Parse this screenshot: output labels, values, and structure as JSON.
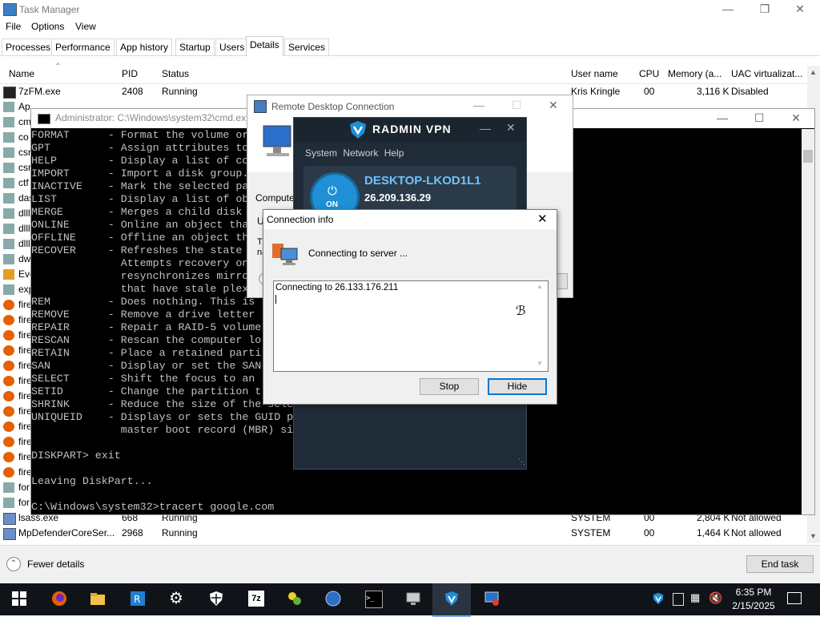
{
  "task_manager": {
    "title": "Task Manager",
    "menu": [
      "File",
      "Options",
      "View"
    ],
    "tabs": [
      "Processes",
      "Performance",
      "App history",
      "Startup",
      "Users",
      "Details",
      "Services"
    ],
    "active_tab": "Details",
    "columns": [
      "Name",
      "PID",
      "Status",
      "User name",
      "CPU",
      "Memory (a...",
      "UAC virtualizat..."
    ],
    "rows_top": [
      {
        "name": "7zFM.exe",
        "pid": "2408",
        "status": "Running",
        "user": "Kris Kringle",
        "cpu": "00",
        "mem": "3,116 K",
        "uac": "Disabled"
      }
    ],
    "rows_bottom": [
      {
        "name": "lsass.exe",
        "pid": "668",
        "status": "Running",
        "user": "SYSTEM",
        "cpu": "00",
        "mem": "2,804 K",
        "uac": "Not allowed"
      },
      {
        "name": "MpDefenderCoreSer...",
        "pid": "2968",
        "status": "Running",
        "user": "SYSTEM",
        "cpu": "00",
        "mem": "1,464 K",
        "uac": "Not allowed"
      }
    ],
    "partial_names": [
      "Ap",
      "cm",
      "co",
      "csr",
      "csr",
      "ctf",
      "das",
      "dlll",
      "dlll",
      "dlll",
      "dw",
      "Eve",
      "exp",
      "fire",
      "fire",
      "fire",
      "fire",
      "fire",
      "fire",
      "fire",
      "fire",
      "fire",
      "fire",
      "fire",
      "fire",
      "for",
      "for"
    ],
    "fewer_details": "Fewer details",
    "end_task": "End task"
  },
  "cmd": {
    "title": "Administrator: C:\\Windows\\system32\\cmd.ex",
    "lines": [
      "FORMAT      - Format the volume or",
      "GPT         - Assign attributes to",
      "HELP        - Display a list of co",
      "IMPORT      - Import a disk group.",
      "INACTIVE    - Mark the selected pa",
      "LIST        - Display a list of ob",
      "MERGE       - Merges a child disk",
      "ONLINE      - Online an object tha",
      "OFFLINE     - Offline an object th",
      "RECOVER     - Refreshes the state",
      "              Attempts recovery on",
      "              resynchronizes mirro",
      "              that have stale plex",
      "REM         - Does nothing. This is",
      "REMOVE      - Remove a drive letter",
      "REPAIR      - Repair a RAID-5 volume",
      "RESCAN      - Rescan the computer lo",
      "RETAIN      - Place a retained parti",
      "SAN         - Display or set the SAN",
      "SELECT      - Shift the focus to an",
      "SETID       - Change the partition t",
      "SHRINK      - Reduce the size of the sele",
      "UNIQUEID    - Displays or sets the GUID p",
      "              master boot record (MBR) si",
      "",
      "DISKPART> exit",
      "",
      "Leaving DiskPart...",
      "",
      "C:\\Windows\\system32>tracert google.com"
    ]
  },
  "rdc": {
    "title": "Remote Desktop Connection",
    "computer_label": "Computer:",
    "u_label": "U",
    "t_label": "Th",
    "na_label": "na"
  },
  "radmin": {
    "brand": "RADMIN VPN",
    "menu": [
      "System",
      "Network",
      "Help"
    ],
    "host": "DESKTOP-LKOD1L1",
    "ip": "26.209.136.29",
    "power": "ON"
  },
  "conn_info": {
    "title": "Connection info",
    "status": "Connecting to server ...",
    "log": "Connecting to 26.133.176.211",
    "stop": "Stop",
    "hide": "Hide"
  },
  "taskbar": {
    "time": "6:35 PM",
    "date": "2/15/2025",
    "icons": [
      "start-icon",
      "firefox-icon",
      "file-explorer-icon",
      "remote-desktop-icon",
      "settings-icon",
      "security-icon",
      "7zip-icon",
      "radmin-viewer-icon",
      "network-globe-icon",
      "cmd-icon",
      "rdc-icon",
      "radmin-vpn-icon",
      "rdp-client-icon"
    ]
  },
  "colors": {
    "taskbar": "#101418",
    "radmin_bg": "#1f2b36",
    "accent": "#1f8fd6",
    "cmd_text": "#c0c0c0"
  }
}
